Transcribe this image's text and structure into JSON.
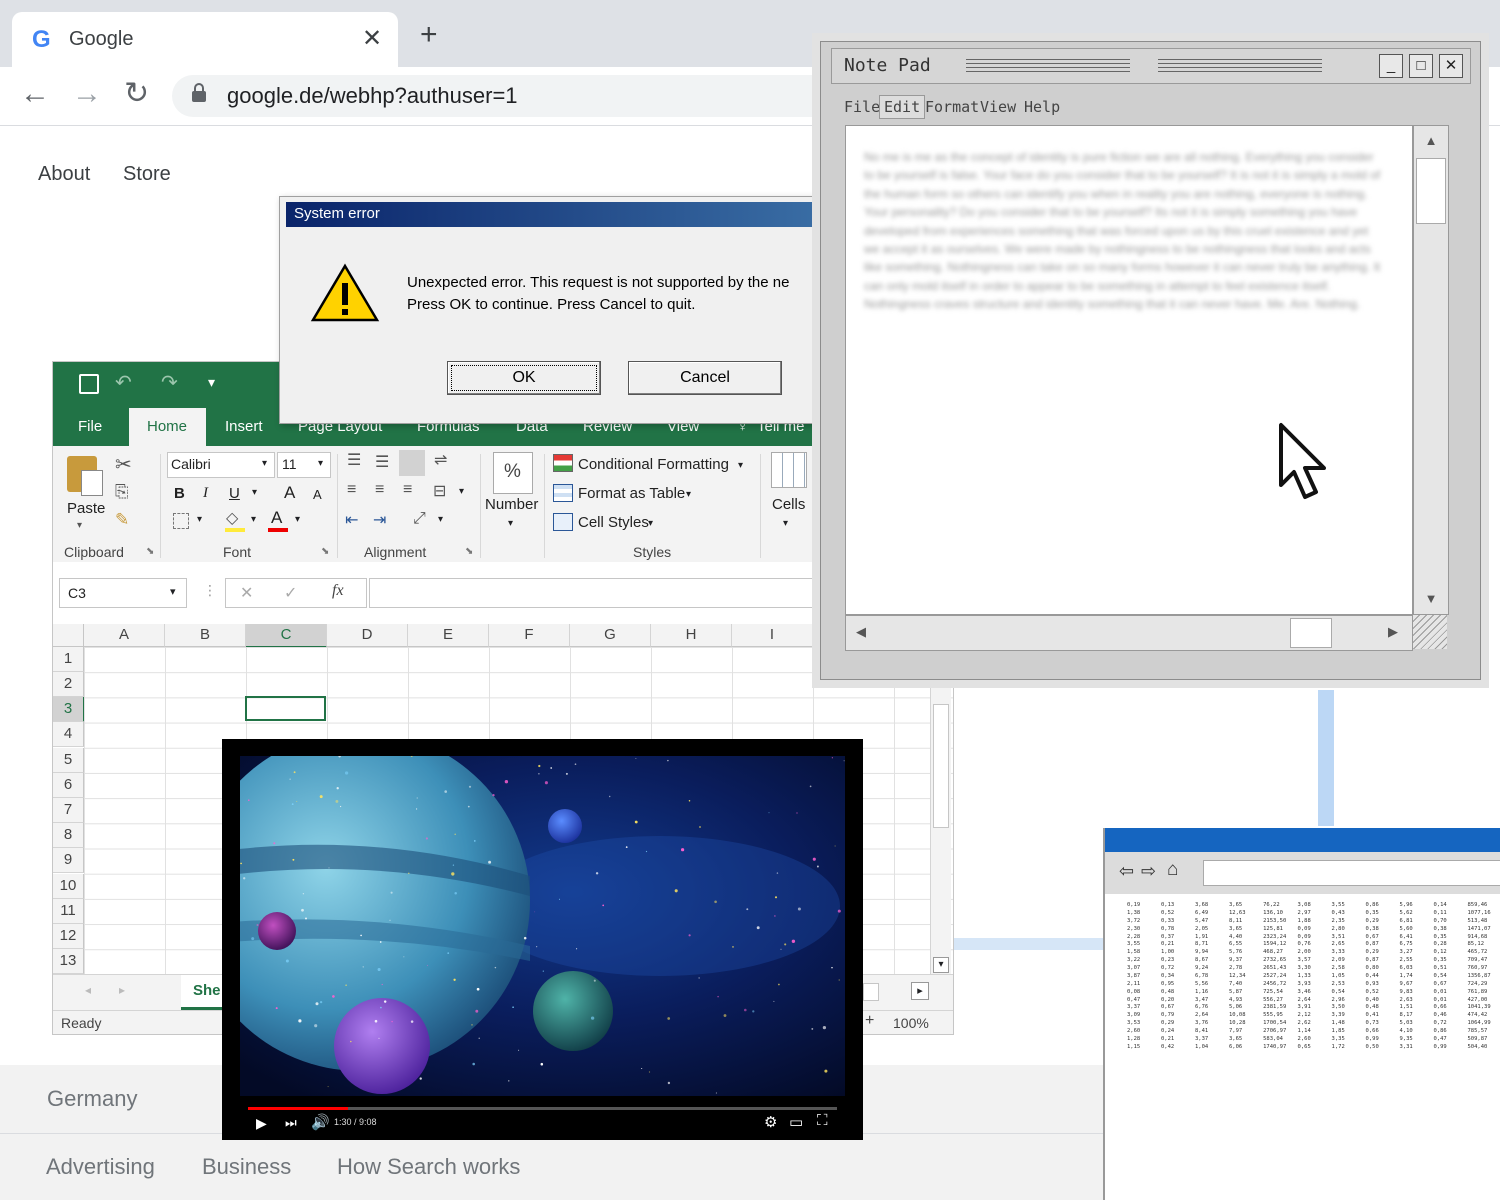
{
  "browser": {
    "tab_title": "Google",
    "tab_icon": "google-g-icon",
    "url": "google.de/webhp?authuser=1",
    "nav_links": [
      "About",
      "Store"
    ],
    "footer_country": "Germany",
    "footer_links": [
      "Advertising",
      "Business",
      "How Search works"
    ]
  },
  "excel": {
    "tabs": [
      "File",
      "Home",
      "Insert",
      "Page Layout",
      "Formulas",
      "Data",
      "Review",
      "View",
      "Tell me"
    ],
    "clipboard": {
      "paste": "Paste",
      "group": "Clipboard"
    },
    "font": {
      "name": "Calibri",
      "size": "11",
      "bold": "B",
      "italic": "I",
      "underline": "U",
      "grow": "A",
      "shrink": "A",
      "font_color": "A",
      "group": "Font"
    },
    "alignment_group": "Alignment",
    "number": {
      "symbol": "%",
      "label": "Number"
    },
    "styles": {
      "conditional": "Conditional Formatting",
      "table": "Format as Table",
      "cell": "Cell Styles",
      "group": "Styles"
    },
    "cells_label": "Cells",
    "name_box": "C3",
    "fx": "fx",
    "columns": [
      "A",
      "B",
      "C",
      "D",
      "E",
      "F",
      "G",
      "H",
      "I"
    ],
    "rows": [
      "1",
      "2",
      "3",
      "4",
      "5",
      "6",
      "7",
      "8",
      "9",
      "10",
      "11",
      "12",
      "13"
    ],
    "sheet_tab": "She",
    "status": "Ready",
    "zoom": "100%",
    "accent": "#217346"
  },
  "dialog": {
    "title": "System error",
    "icon": "warning-icon",
    "line1": "Unexpected error. This request is not supported by the ne",
    "line2": "Press OK to continue. Press Cancel to quit.",
    "ok": "OK",
    "cancel": "Cancel"
  },
  "notepad": {
    "title": "Note Pad",
    "menu": [
      "File",
      "Edit",
      "Format",
      "View",
      "Help"
    ],
    "body": "No me is me as the concept of identity is pure fiction we are all nothing. Everything you consider to be yourself is false. Your face do you consider that to be yourself? It is not it is simply a mold of the human form so others can identify you when in reality you are nothing, everyone is nothing. Your personality? Do you consider that to be yourself? Its not it is simply something you have developed from experiences something that was forced upon us by this cruel existence and yet we accept it as ourselves. We were made by nothingness to be nothingness that looks and acts like something. Nothingness can take on so many forms however it can never truly be anything. It can only mold itself in order to appear to be something in attempt to feel existence itself. Nothingness craves structure and identity something that it can never have. Me. Are. Nothing."
  },
  "video": {
    "time": "1:30 / 9:08",
    "progress": 0.17
  },
  "mini_browser": {
    "table": [
      [
        "0,19",
        "0,13",
        "3,68",
        "3,65",
        "76,22",
        "3,08",
        "3,55",
        "0,86",
        "5,96",
        "0,14",
        "859,46"
      ],
      [
        "1,38",
        "0,52",
        "6,49",
        "12,63",
        "136,10",
        "2,97",
        "0,43",
        "0,35",
        "5,62",
        "0,11",
        "1077,16"
      ],
      [
        "3,72",
        "0,33",
        "5,47",
        "8,11",
        "2153,50",
        "1,88",
        "2,35",
        "0,29",
        "6,81",
        "0,70",
        "513,48"
      ],
      [
        "2,30",
        "0,78",
        "2,05",
        "3,65",
        "125,81",
        "0,09",
        "2,80",
        "0,38",
        "5,60",
        "0,38",
        "1471,07"
      ],
      [
        "2,28",
        "0,37",
        "1,91",
        "4,40",
        "2323,24",
        "0,09",
        "3,51",
        "0,67",
        "6,41",
        "0,35",
        "914,68"
      ],
      [
        "3,55",
        "0,21",
        "8,71",
        "6,55",
        "1594,12",
        "0,76",
        "2,65",
        "0,87",
        "6,75",
        "0,28",
        "85,12"
      ],
      [
        "1,58",
        "1,00",
        "9,94",
        "5,76",
        "468,27",
        "2,00",
        "3,33",
        "0,29",
        "3,27",
        "0,12",
        "465,72"
      ],
      [
        "3,22",
        "0,23",
        "8,67",
        "9,37",
        "2732,65",
        "3,57",
        "2,09",
        "0,87",
        "2,55",
        "0,35",
        "709,47"
      ],
      [
        "3,07",
        "0,72",
        "9,24",
        "2,78",
        "2651,43",
        "3,30",
        "2,58",
        "0,80",
        "6,03",
        "0,51",
        "760,97"
      ],
      [
        "3,87",
        "0,34",
        "6,78",
        "12,34",
        "2527,24",
        "1,33",
        "1,05",
        "0,44",
        "1,74",
        "0,54",
        "1356,87"
      ],
      [
        "2,11",
        "0,95",
        "5,56",
        "7,40",
        "2456,72",
        "3,93",
        "2,53",
        "0,93",
        "9,67",
        "0,67",
        "724,29"
      ],
      [
        "0,08",
        "0,48",
        "1,16",
        "5,87",
        "725,54",
        "3,46",
        "0,54",
        "0,52",
        "9,83",
        "0,01",
        "761,89"
      ],
      [
        "0,47",
        "0,20",
        "3,47",
        "4,93",
        "556,27",
        "2,64",
        "2,96",
        "0,40",
        "2,63",
        "0,01",
        "427,00"
      ],
      [
        "3,37",
        "0,67",
        "6,76",
        "5,06",
        "2381,59",
        "3,91",
        "3,50",
        "0,48",
        "1,51",
        "0,66",
        "1041,39"
      ],
      [
        "3,09",
        "0,79",
        "2,64",
        "10,08",
        "555,95",
        "2,12",
        "3,39",
        "0,41",
        "8,17",
        "0,46",
        "474,42"
      ],
      [
        "3,53",
        "0,29",
        "3,76",
        "10,28",
        "1700,54",
        "2,62",
        "1,48",
        "0,73",
        "5,03",
        "0,72",
        "1064,99"
      ],
      [
        "2,60",
        "0,24",
        "8,41",
        "7,97",
        "2706,97",
        "1,14",
        "1,85",
        "0,66",
        "4,10",
        "0,86",
        "785,57"
      ],
      [
        "1,28",
        "0,21",
        "3,37",
        "3,65",
        "583,04",
        "2,60",
        "3,35",
        "0,99",
        "9,35",
        "0,47",
        "509,87"
      ],
      [
        "1,15",
        "0,42",
        "1,04",
        "6,06",
        "1740,97",
        "0,65",
        "1,72",
        "0,50",
        "3,31",
        "0,99",
        "504,40"
      ]
    ]
  }
}
